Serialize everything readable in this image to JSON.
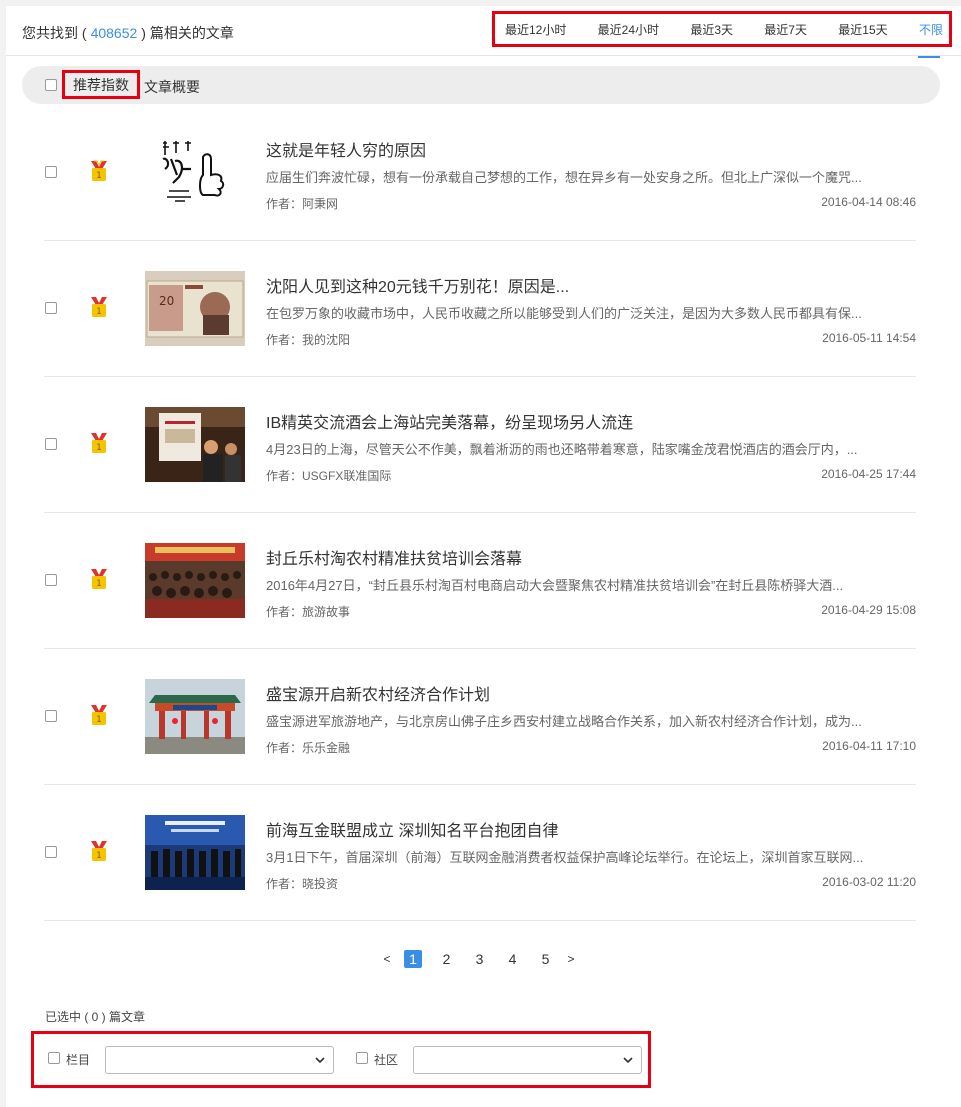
{
  "header": {
    "found_prefix": "您共找到 (",
    "found_count": "408652",
    "found_suffix": ") 篇相关的文章",
    "time_filters": [
      {
        "label": "最近12小时",
        "active": false
      },
      {
        "label": "最近24小时",
        "active": false
      },
      {
        "label": "最近3天",
        "active": false
      },
      {
        "label": "最近7天",
        "active": false
      },
      {
        "label": "最近15天",
        "active": false
      },
      {
        "label": "不限",
        "active": true
      }
    ]
  },
  "sortbar": {
    "recommend_label": "推荐指数",
    "summary_label": "文章概要"
  },
  "articles": [
    {
      "medal": "1",
      "thumb": "calligraphy",
      "title": "这就是年轻人穷的原因",
      "summary": "应届生们奔波忙碌，想有一份承载自己梦想的工作，想在异乡有一处安身之所。但北上广深似一个魔咒...",
      "author": "作者：阿秉网",
      "date": "2016-04-14 08:46"
    },
    {
      "medal": "1",
      "thumb": "banknote",
      "title": "沈阳人见到这种20元钱千万别花！原因是...",
      "summary": "在包罗万象的收藏市场中，人民币收藏之所以能够受到人们的广泛关注，是因为大多数人民币都具有保...",
      "author": "作者：我的沈阳",
      "date": "2016-05-11 14:54"
    },
    {
      "medal": "1",
      "thumb": "banquet",
      "title": "IB精英交流酒会上海站完美落幕，纷呈现场另人流连",
      "summary": "4月23日的上海，尽管天公不作美，飘着淅沥的雨也还略带着寒意，陆家嘴金茂君悦酒店的酒会厅内，...",
      "author": "作者：USGFX联准国际",
      "date": "2016-04-25 17:44"
    },
    {
      "medal": "1",
      "thumb": "meeting",
      "title": "封丘乐村淘农村精准扶贫培训会落幕",
      "summary": "2016年4月27日，“封丘县乐村淘百村电商启动大会暨聚焦农村精准扶贫培训会”在封丘县陈桥驿大酒...",
      "author": "作者：旅游故事",
      "date": "2016-04-29 15:08"
    },
    {
      "medal": "1",
      "thumb": "gate",
      "title": "盛宝源开启新农村经济合作计划",
      "summary": "盛宝源进军旅游地产，与北京房山佛子庄乡西安村建立战略合作关系，加入新农村经济合作计划，成为...",
      "author": "作者：乐乐金融",
      "date": "2016-04-11 17:10"
    },
    {
      "medal": "1",
      "thumb": "stage",
      "title": "前海互金联盟成立 深圳知名平台抱团自律",
      "summary": "3月1日下午，首届深圳（前海）互联网金融消费者权益保护高峰论坛举行。在论坛上，深圳首家互联网...",
      "author": "作者：晓投资",
      "date": "2016-03-02 11:20"
    }
  ],
  "pager": {
    "prev": "<",
    "pages": [
      "1",
      "2",
      "3",
      "4",
      "5"
    ],
    "current": "1",
    "next": ">"
  },
  "selection": {
    "count_text": "已选中 ( 0 ) 篇文章",
    "column_label": "栏目",
    "column_value": "",
    "community_label": "社区",
    "community_value": ""
  },
  "colors": {
    "accent": "#3a8ee6",
    "highlight_border": "#e60012",
    "medal_gold": "#f5c400",
    "medal_red": "#e0322b"
  }
}
